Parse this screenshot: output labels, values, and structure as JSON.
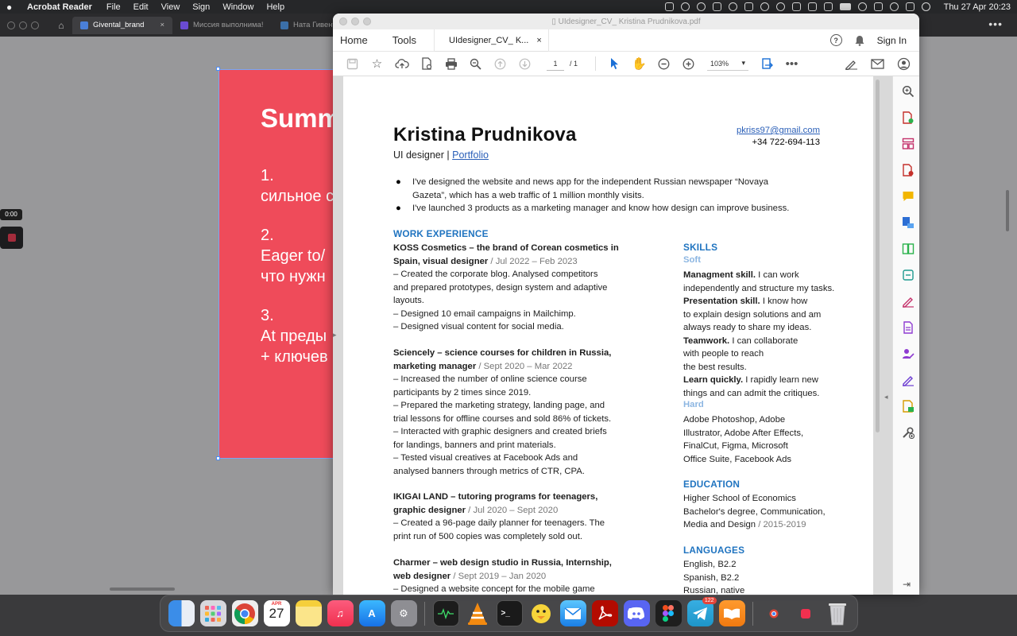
{
  "menubar": {
    "app_name": "Acrobat Reader",
    "items": [
      "File",
      "Edit",
      "View",
      "Sign",
      "Window",
      "Help"
    ],
    "clock": "Thu 27 Apr  20:23"
  },
  "background_window": {
    "tabs": [
      {
        "label": "Givental_brand",
        "close": "×"
      },
      {
        "label": "Миссия выполнима!"
      },
      {
        "label": "Ната Гивенталь"
      }
    ],
    "slide": {
      "title": "Summ",
      "lines": [
        "1.",
        "сильное с",
        "2.",
        "Eager to/",
        "что нужн",
        "3.",
        "At преды",
        "+ ключев"
      ]
    },
    "timer": "0:00"
  },
  "acrobat": {
    "window_title": "UIdesigner_CV_ Kristina Prudnikova.pdf",
    "nav_home": "Home",
    "nav_tools": "Tools",
    "doc_tab": "UIdesigner_CV_ K...",
    "doc_tab_close": "×",
    "sign_in": "Sign In",
    "page_current": "1",
    "page_total": "/  1",
    "zoom": "103%"
  },
  "cv": {
    "name": "Kristina Prudnikova",
    "role": "UI designer | ",
    "portfolio": "Portfolio",
    "email": "pkriss97@gmail.com",
    "phone": "+34 722-694-113",
    "intro": [
      [
        "I've designed the website and news app for the independent Russian newspaper “Novaya",
        "Gazeta”, which has a web traffic of 1 million monthly visits."
      ],
      [
        "I've launched 3 products as a marketing manager and know how design can improve business."
      ]
    ],
    "work_heading": "WORK EXPERIENCE",
    "jobs": [
      {
        "title1": "KOSS Cosmetics – the brand of Corean cosmetics in",
        "title2": "Spain, visual designer",
        "dates": " / Jul 2022 – Feb 2023",
        "lines": [
          "– Created the corporate blog. Analysed competitors",
          "and prepared prototypes, design system and adaptive",
          "layouts.",
          "– Designed 10 email campaigns in Mailchimp.",
          "– Designed visual content for social media."
        ]
      },
      {
        "title1": "Sciencely – science courses for children in Russia,",
        "title2": "marketing manager",
        "dates": " / Sept 2020 – Mar 2022",
        "lines": [
          "– Increased the number of online science course",
          "participants by 2 times since 2019.",
          "– Prepared the marketing strategy, landing page, and",
          "trial lessons for offline courses and sold 86% of tickets.",
          "– Interacted with graphic designers and created briefs",
          "for landings, banners and print materials.",
          "– Tested visual creatives at Facebook Ads and",
          "analysed banners through metrics of CTR, CPA."
        ]
      },
      {
        "title1": "IKIGAI LAND – tutoring programs for teenagers,",
        "title2": "graphic designer",
        "dates": " / Jul 2020 – Sept 2020",
        "lines": [
          "– Created a 96-page daily planner for teenagers. The",
          "print run of 500 copies was completely sold out."
        ]
      },
      {
        "title1": "Charmer – web design studio in Russia, Internship,",
        "title2": "web designer",
        "dates": " / Sept 2019 – Jan 2020",
        "lines": [
          "– Designed a website concept for the mobile game"
        ]
      }
    ],
    "skills_heading": "SKILLS",
    "soft_heading": "Soft",
    "soft_skills": [
      {
        "name": "Managment skill.",
        "lines": [
          " I can work",
          "independently and structure my tasks."
        ]
      },
      {
        "name": "Presentation skill.",
        "lines": [
          " I know how",
          "to explain design solutions and am",
          "always ready to share my ideas."
        ]
      },
      {
        "name": "Teamwork.",
        "lines": [
          " I can collaborate",
          "with people to reach",
          "the best results."
        ]
      },
      {
        "name": "Learn quickly.",
        "lines": [
          " I rapidly learn new",
          "things and can admit the critiques."
        ]
      }
    ],
    "hard_heading": "Hard",
    "hard_skills": [
      "Adobe Photoshop, Adobe",
      "Illustrator, Adobe After Effects,",
      "FinalCut, Figma, Microsoft",
      "Office Suite, Facebook Ads"
    ],
    "education_heading": "EDUCATION",
    "education": {
      "school": "Higher School of Economics",
      "degree1": "Bachelor's degree, Communication,",
      "degree2": "Media and Design",
      "years": " / 2015-2019"
    },
    "languages_heading": "LANGUAGES",
    "languages": [
      "English, B2.2",
      "Spanish, B2.2",
      "Russian, native"
    ]
  },
  "dock": {
    "calendar_month": "APR",
    "calendar_day": "27",
    "telegram_badge": "122"
  },
  "colors": {
    "accent_blue": "#2074c0",
    "subhead_blue": "#8cb6e2",
    "slide_red": "#ef4b5a",
    "link_blue": "#2a5fb8"
  }
}
